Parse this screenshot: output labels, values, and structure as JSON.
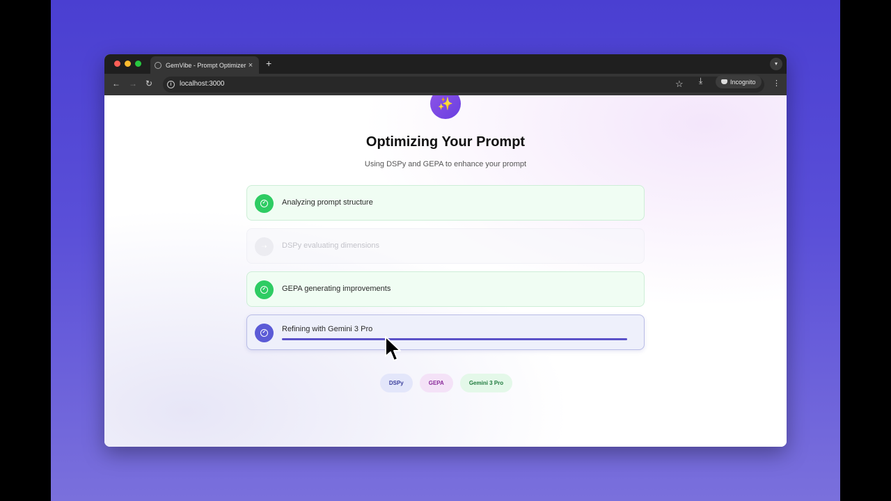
{
  "browser": {
    "tab_title": "GemVibe - Prompt Optimizer",
    "tab_close": "×",
    "new_tab": "+",
    "url": "localhost:3000",
    "incognito_label": "Incognito"
  },
  "page": {
    "logo_icon": "sparkles-icon",
    "title": "Optimizing Your Prompt",
    "subtitle": "Using DSPy and GEPA to enhance your prompt",
    "steps": [
      {
        "label": "Analyzing prompt structure",
        "status": "done"
      },
      {
        "label": "DSPy evaluating dimensions",
        "status": "pending"
      },
      {
        "label": "GEPA generating improvements",
        "status": "done"
      },
      {
        "label": "Refining with Gemini 3 Pro",
        "status": "active",
        "progress": 1.0
      }
    ],
    "chips": [
      "DSPy",
      "GEPA",
      "Gemini 3 Pro"
    ]
  },
  "colors": {
    "accent": "#5b5bd6",
    "done_green": "#2ecc63",
    "backdrop": "#4a3fd1"
  }
}
